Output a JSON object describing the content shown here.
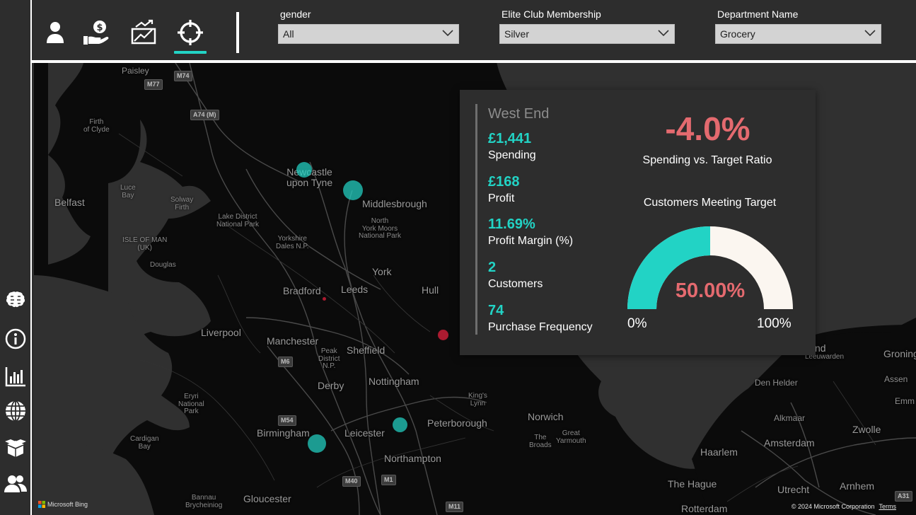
{
  "colors": {
    "accent": "#22d3c5",
    "negative": "#e46a6f",
    "gauge_remainder": "#fbf6f0",
    "background": "#2d2d2d",
    "map_background": "#0d0d0d",
    "bubble_red": "#c81e37"
  },
  "left_nav": [
    {
      "icon": "brain-icon"
    },
    {
      "icon": "info-icon"
    },
    {
      "icon": "bar-chart-icon"
    },
    {
      "icon": "globe-icon"
    },
    {
      "icon": "box-icon"
    },
    {
      "icon": "users-icon"
    }
  ],
  "top_nav": [
    {
      "icon": "person-icon",
      "active": false
    },
    {
      "icon": "hand-money-icon",
      "active": false
    },
    {
      "icon": "trend-chart-icon",
      "active": false
    },
    {
      "icon": "crosshair-icon",
      "active": true
    }
  ],
  "filters": {
    "gender": {
      "label": "gender",
      "value": "All"
    },
    "membership": {
      "label": "Elite Club Membership",
      "value": "Silver"
    },
    "department": {
      "label": "Department Name",
      "value": "Grocery"
    }
  },
  "map": {
    "labels": {
      "paisley": "Paisley",
      "firth": "Firth\nof Clyde",
      "luce": "Luce\nBay",
      "belfast": "Belfast",
      "solway": "Solway\nFirth",
      "newcastle": "Newcastle\nupon Tyne",
      "middlesbrough": "Middlesbrough",
      "lake": "Lake District\nNational Park",
      "isleofman": "ISLE OF MAN\n(UK)",
      "douglas": "Douglas",
      "yorkshire": "Yorkshire\nDales N.P.",
      "northyork": "North\nYork Moors\nNational Park",
      "york": "York",
      "bradford": "Bradford",
      "leeds": "Leeds",
      "hull": "Hull",
      "liverpool": "Liverpool",
      "manchester": "Manchester",
      "peak": "Peak\nDistrict\nN.P.",
      "sheffield": "Sheffield",
      "derby": "Derby",
      "nottingham": "Nottingham",
      "kingslynn": "King's\nLynn",
      "norwich": "Norwich",
      "greatyarmouth": "Great\nYarmouth",
      "broads": "The\nBroads",
      "peterborough": "Peterborough",
      "leicester": "Leicester",
      "birmingham": "Birmingham",
      "eryri": "Eryri\nNational\nPark",
      "cardigan": "Cardigan\nBay",
      "northampton": "Northampton",
      "gloucester": "Gloucester",
      "bannau": "Bannau\nBrycheiniog",
      "groningen": "Groninge",
      "leeuwarden": "Leeuwarden",
      "assen": "Assen",
      "emm": "Emm",
      "denhelder": "Den Helder",
      "alkmaar": "Alkmaar",
      "zwolle": "Zwolle",
      "haarlem": "Haarlem",
      "amsterdam": "Amsterdam",
      "thehague": "The Hague",
      "utrecht": "Utrecht",
      "arnhem": "Arnhem",
      "rotterdam": "Rotterdam",
      "nd": "nd"
    },
    "shields": {
      "m74": "M74",
      "m77": "M77",
      "a74m": "A74 (M)",
      "m6": "M6",
      "m54": "M54",
      "m40": "M40",
      "m1": "M1",
      "m11": "M11",
      "a31": "A31"
    },
    "bubbles": [
      {
        "city": "Newcastle",
        "color": "teal"
      },
      {
        "city": "Middlesbrough",
        "color": "teal"
      },
      {
        "city": "Bradford",
        "color": "red"
      },
      {
        "city": "Hull coast",
        "color": "red"
      },
      {
        "city": "Leicester east",
        "color": "teal"
      },
      {
        "city": "Birmingham",
        "color": "teal"
      }
    ],
    "attribution": "Microsoft Bing",
    "copyright": "© 2024 Microsoft Corporation",
    "terms": "Terms"
  },
  "tooltip": {
    "location": "West End",
    "metrics": [
      {
        "value": "£1,441",
        "label": "Spending"
      },
      {
        "value": "£168",
        "label": "Profit"
      },
      {
        "value": "11.69%",
        "label": "Profit Margin (%)"
      },
      {
        "value": "2",
        "label": "Customers"
      },
      {
        "value": "74",
        "label": "Purchase Frequency"
      }
    ],
    "ratio_value": "-4.0%",
    "ratio_label": "Spending vs. Target Ratio",
    "gauge": {
      "title": "Customers Meeting Target",
      "value": "50.00%",
      "fraction": 0.5,
      "min": "0%",
      "max": "100%"
    }
  }
}
